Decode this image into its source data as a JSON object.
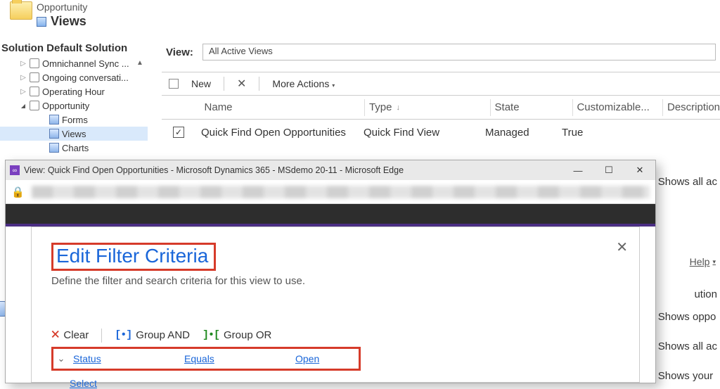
{
  "header": {
    "entity": "Opportunity",
    "views": "Views"
  },
  "solution_bar": "Solution Default Solution",
  "tree": {
    "items": [
      "Omnichannel Sync ...",
      "Ongoing conversati...",
      "Operating Hour",
      "Opportunity"
    ],
    "children": [
      "Forms",
      "Views",
      "Charts"
    ]
  },
  "view_picker": {
    "label": "View:",
    "value": "All Active Views"
  },
  "toolbar": {
    "new": "New",
    "more": "More Actions"
  },
  "grid": {
    "cols": {
      "name": "Name",
      "type": "Type",
      "state": "State",
      "cust": "Customizable...",
      "desc": "Description"
    },
    "row": {
      "name": "Quick Find Open Opportunities",
      "type": "Quick Find View",
      "state": "Managed",
      "cust": "True"
    }
  },
  "right_fragments": [
    "Shows all ac",
    "Shows oppo",
    "Shows all ac",
    "Shows your"
  ],
  "tion": "ution",
  "help": "Help",
  "popup": {
    "title": "View: Quick Find Open Opportunities - Microsoft Dynamics 365 - MSdemo 20-11 - Microsoft Edge"
  },
  "dialog": {
    "title": "Edit Filter Criteria",
    "sub": "Define the filter and search criteria for this view to use.",
    "toolbar": {
      "clear": "Clear",
      "and": "Group AND",
      "or": "Group OR"
    },
    "row": {
      "field": "Status",
      "op": "Equals",
      "val": "Open"
    },
    "select": "Select"
  },
  "lp": "F"
}
